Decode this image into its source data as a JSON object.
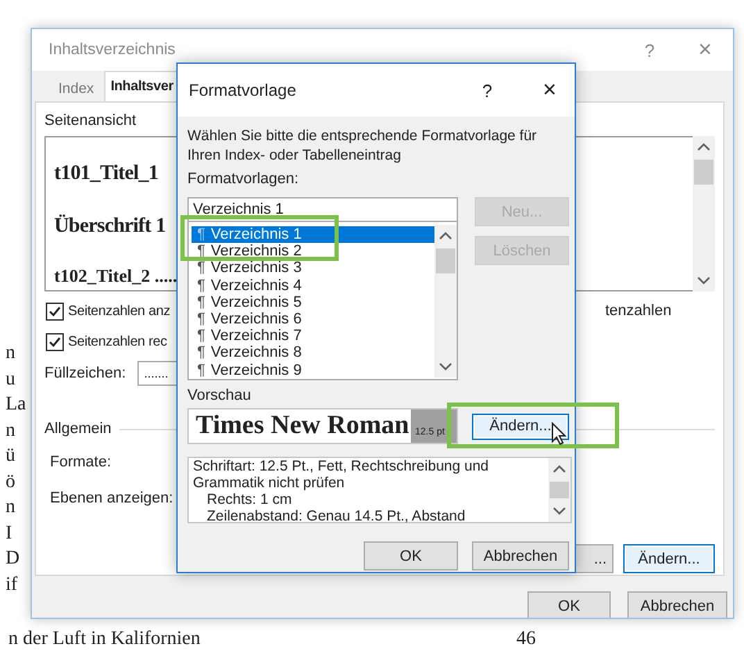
{
  "document": {
    "margin_fragments": [
      "n",
      "u",
      "La",
      "n",
      "ü",
      "ö",
      "n",
      "I",
      "D",
      "if"
    ],
    "bottom_line": "n der Luft in Kalifornien",
    "page_number": "46"
  },
  "toc_dialog": {
    "title": "Inhaltsverzeichnis",
    "help": "?",
    "close": "×",
    "tabs": [
      {
        "label": "Index",
        "selected": false
      },
      {
        "label": "Inhaltsver",
        "selected": true
      }
    ],
    "preview_label": "Seitenansicht",
    "preview_lines": [
      "t101_Titel_1",
      "Überschrift 1",
      "t102_Titel_2 ....."
    ],
    "checkboxes": [
      {
        "label": "Seitenzahlen anz",
        "checked": true
      },
      {
        "label": "Seitenzahlen rec",
        "checked": true
      }
    ],
    "right_fragment": "tenzahlen",
    "fill_label": "Füllzeichen:",
    "fill_value": ".......",
    "group_label": "Allgemein",
    "formats_label": "Formate:",
    "levels_label": "Ebenen anzeigen:",
    "side_buttons": [
      "...",
      "Ändern..."
    ],
    "buttons": [
      "OK",
      "Abbrechen"
    ]
  },
  "style_dialog": {
    "title": "Formatvorlage",
    "help": "?",
    "close": "×",
    "instruction": "Wählen Sie bitte die entsprechende Formatvorlage für Ihren Index- oder Tabelleneintrag",
    "styles_label": "Formatvorlagen:",
    "style_value": "Verzeichnis 1",
    "side_buttons": [
      {
        "label": "Neu...",
        "disabled": true
      },
      {
        "label": "Löschen",
        "disabled": true
      }
    ],
    "items": [
      {
        "mark": "¶",
        "label": "Verzeichnis 1",
        "selected": true
      },
      {
        "mark": "¶",
        "label": "Verzeichnis 2",
        "selected": false
      },
      {
        "mark": "¶",
        "label": "Verzeichnis 3",
        "selected": false
      },
      {
        "mark": "¶",
        "label": "Verzeichnis 4",
        "selected": false
      },
      {
        "mark": "¶",
        "label": "Verzeichnis 5",
        "selected": false
      },
      {
        "mark": "¶",
        "label": "Verzeichnis 6",
        "selected": false
      },
      {
        "mark": "¶",
        "label": "Verzeichnis 7",
        "selected": false
      },
      {
        "mark": "¶",
        "label": "Verzeichnis 8",
        "selected": false
      },
      {
        "mark": "¶",
        "label": "Verzeichnis 9",
        "selected": false
      }
    ],
    "preview_label": "Vorschau",
    "preview_font": "Times New Roman",
    "preview_size": "12.5 pt",
    "modify_button": "Ändern...",
    "description": {
      "lines": [
        "Schriftart: 12.5 Pt., Fett, Rechtschreibung und",
        "Grammatik nicht prüfen"
      ],
      "details": [
        "Rechts:  1 cm",
        "Zeilenabstand:  Genau 14.5 Pt., Abstand"
      ]
    },
    "buttons": [
      "OK",
      "Abbrechen"
    ]
  }
}
